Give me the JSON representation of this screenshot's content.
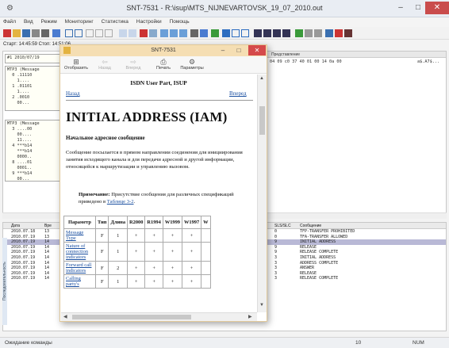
{
  "window": {
    "title": "SNT-7531 - R:\\isup\\MTS_NIJNEVARTOVSK_19_07_2010.out",
    "min_btn": "–",
    "max_btn": "□",
    "close_btn": "✕"
  },
  "menu": [
    "Файл",
    "Вид",
    "Режим",
    "Мониторинг",
    "Статистика",
    "Настройки",
    "Помощь"
  ],
  "start_line": "Старт: 14:45:59  Стоп: 14:51:06",
  "right_pane": {
    "header": "Представление",
    "hex": "04 09 c0 37 40 01 00 14 0a 00",
    "hex2": "a$.A7$..."
  },
  "left_messages": [
    "#1 2010/07/19",
    "MTP3 (Message\n  0 .11110\n    1....\n  1 .01101\n    1....\n  2 .0010\n    00...",
    "MTP3 (Message\n  3 ....00\n    00....\n    11....\n  4 ***b14\n    ***b14\n    0000..\n  8 ....01\n    0001..\n  9 ***b14\n    00..."
  ],
  "bottom_table": {
    "columns": [
      "Дата",
      "Вре",
      "SLS/SLC",
      "Сообщение"
    ],
    "rows": [
      {
        "date": "2010.07.18",
        "time": "13",
        "sls": "0",
        "msg": "TFP-TRANSFER PROHIBITED",
        "sel": false
      },
      {
        "date": "2010.07.19",
        "time": "13",
        "sls": "0",
        "msg": "TFA-TRANSFER ALLOWED",
        "sel": false
      },
      {
        "date": "2010.07.19",
        "time": "14",
        "sls": "9",
        "msg": "INITIAL ADDRESS",
        "sel": true
      },
      {
        "date": "2010.07.19",
        "time": "14",
        "sls": "9",
        "msg": "RELEASE",
        "sel": false
      },
      {
        "date": "2010.07.19",
        "time": "14",
        "sls": "9",
        "msg": "RELEASE COMPLETE",
        "sel": false
      },
      {
        "date": "2010.07.19",
        "time": "14",
        "sls": "3",
        "msg": "INITIAL ADDRESS",
        "sel": false
      },
      {
        "date": "2010.07.19",
        "time": "14",
        "sls": "3",
        "msg": "ADDRESS COMPLETE",
        "sel": false
      },
      {
        "date": "2010.07.19",
        "time": "14",
        "sls": "3",
        "msg": "ANSWER",
        "sel": false
      },
      {
        "date": "2010.07.19",
        "time": "14",
        "sls": "3",
        "msg": "RELEASE",
        "sel": false
      },
      {
        "date": "2010.07.19",
        "time": "14",
        "sls": "3",
        "msg": "RELEASE COMPLETE",
        "sel": false
      }
    ],
    "side_tab": "Последовательность"
  },
  "status": {
    "left": "Ожидание команды",
    "mid": "10",
    "right": "NUM"
  },
  "help": {
    "title": "SNT-7531",
    "toolbar": [
      {
        "label": "Отобразить",
        "icon": "⊞",
        "disabled": false
      },
      {
        "label": "Назад",
        "icon": "⇦",
        "disabled": true
      },
      {
        "label": "Вперед",
        "icon": "⇨",
        "disabled": true
      },
      {
        "label": "Печать",
        "icon": "⎙",
        "disabled": false
      },
      {
        "label": "Параметры",
        "icon": "⚙",
        "disabled": false
      }
    ],
    "subject": "ISDN User Part, ISUP",
    "back": "Назад",
    "forward": "Вперед",
    "heading": "INITIAL ADDRESS (IAM)",
    "subheading": "Начальное адресное сообщение",
    "paragraph": "Сообщение посылается в прямом направлении соединения для инициирования занятия исходящего канала и для передачи адресной и другой информации, относящейся к маршрутизации и управлению вызовом.",
    "note_label": "Примечание:",
    "note_text": " Присутствие сообщения для различных спецификаций приведено в ",
    "note_link": "Таблице 3-2",
    "note_end": ".",
    "table": {
      "headers": [
        "Параметр",
        "Тип",
        "Длина",
        "R2000",
        "R1994",
        "W1999",
        "W1997",
        "W"
      ],
      "rows": [
        {
          "name": "Message Type",
          "type": "F",
          "len": "1",
          "cells": [
            "+",
            "+",
            "+",
            "+"
          ]
        },
        {
          "name": "Nature of connection indicators",
          "type": "F",
          "len": "1",
          "cells": [
            "+",
            "+",
            "+",
            "+"
          ]
        },
        {
          "name": "Forward call indicators",
          "type": "F",
          "len": "2",
          "cells": [
            "+",
            "+",
            "+",
            "+"
          ]
        },
        {
          "name": "Calling party's",
          "type": "F",
          "len": "1",
          "cells": [
            "+",
            "+",
            "+",
            "+"
          ]
        }
      ]
    }
  }
}
